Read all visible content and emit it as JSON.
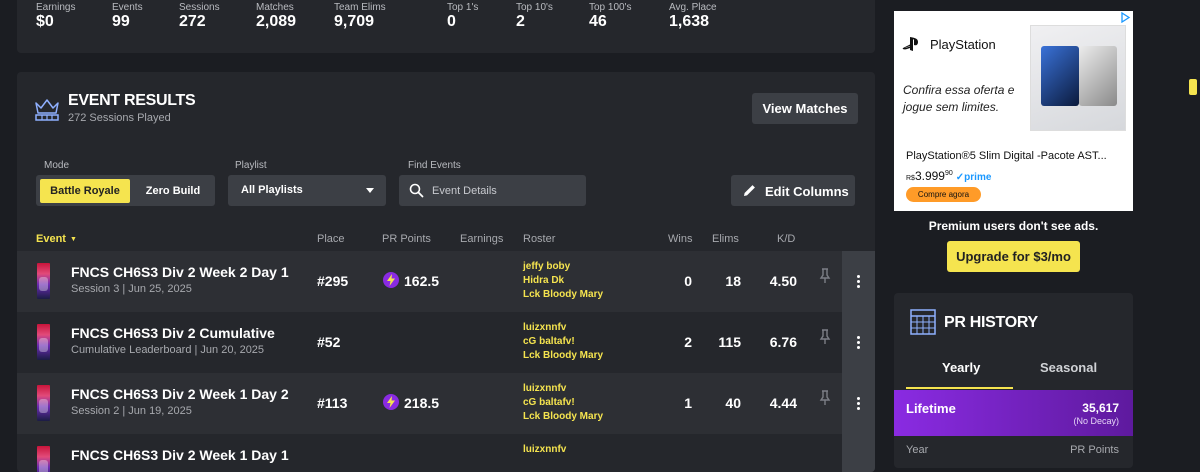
{
  "stats": [
    {
      "label": "Earnings",
      "value": "$0"
    },
    {
      "label": "Events",
      "value": "99"
    },
    {
      "label": "Sessions",
      "value": "272"
    },
    {
      "label": "Matches",
      "value": "2,089"
    },
    {
      "label": "Team Elims",
      "value": "9,709"
    },
    {
      "label": "Top 1's",
      "value": "0"
    },
    {
      "label": "Top 10's",
      "value": "2"
    },
    {
      "label": "Top 100's",
      "value": "46"
    },
    {
      "label": "Avg. Place",
      "value": "1,638"
    }
  ],
  "event_results": {
    "title": "EVENT RESULTS",
    "subtitle": "272 Sessions Played",
    "view_matches_label": "View Matches",
    "filters": {
      "mode_label": "Mode",
      "mode_options": [
        "Battle Royale",
        "Zero Build"
      ],
      "mode_selected": "Battle Royale",
      "playlist_label": "Playlist",
      "playlist_value": "All Playlists",
      "find_label": "Find Events",
      "find_placeholder": "Event Details",
      "edit_columns_label": "Edit Columns"
    },
    "columns": {
      "event": "Event",
      "place": "Place",
      "pr_points": "PR Points",
      "earnings": "Earnings",
      "roster": "Roster",
      "wins": "Wins",
      "elims": "Elims",
      "kd": "K/D"
    },
    "rows": [
      {
        "name": "FNCS CH6S3 Div 2 Week 2 Day 1",
        "sub": "Session 3 | Jun 25, 2025",
        "place": "#295",
        "pr": "162.5",
        "earnings": "",
        "roster": [
          "jeffy boby",
          "Hidra Dk",
          "Lck Bloody Mary"
        ],
        "wins": "0",
        "elims": "18",
        "kd": "4.50"
      },
      {
        "name": "FNCS CH6S3 Div 2 Cumulative",
        "sub": "Cumulative Leaderboard | Jun 20, 2025",
        "place": "#52",
        "pr": "",
        "earnings": "",
        "roster": [
          "luizxnnfv",
          "cG baltafv!",
          "Lck Bloody Mary"
        ],
        "wins": "2",
        "elims": "115",
        "kd": "6.76"
      },
      {
        "name": "FNCS CH6S3 Div 2 Week 1 Day 2",
        "sub": "Session 2 | Jun 19, 2025",
        "place": "#113",
        "pr": "218.5",
        "earnings": "",
        "roster": [
          "luizxnnfv",
          "cG baltafv!",
          "Lck Bloody Mary"
        ],
        "wins": "1",
        "elims": "40",
        "kd": "4.44"
      },
      {
        "name": "FNCS CH6S3 Div 2 Week 1 Day 1",
        "sub": "",
        "place": "",
        "pr": "",
        "earnings": "",
        "roster": [
          "luizxnnfv"
        ],
        "wins": "",
        "elims": "",
        "kd": ""
      }
    ]
  },
  "ad": {
    "brand": "PlayStation",
    "copy_line1": "Confira essa oferta e",
    "copy_line2": "jogue sem limites.",
    "product_title": "PlayStation®5 Slim Digital -Pacote AST...",
    "price_currency": "R$",
    "price_main": "3.999",
    "price_cents": "90",
    "prime_label": "prime",
    "cta": "Compre agora"
  },
  "premium_note": "Premium users don't see ads.",
  "upgrade_label": "Upgrade for $3/mo",
  "pr_history": {
    "title": "PR HISTORY",
    "tabs": [
      "Yearly",
      "Seasonal"
    ],
    "active_tab": "Yearly",
    "lifetime_label": "Lifetime",
    "lifetime_value": "35,617",
    "lifetime_note": "(No Decay)",
    "col_year": "Year",
    "col_points": "PR Points"
  },
  "colors": {
    "accent": "#f5e44f",
    "pr_purple": "#8a2be2",
    "panel": "#25272c",
    "bg": "#1b1d22"
  }
}
